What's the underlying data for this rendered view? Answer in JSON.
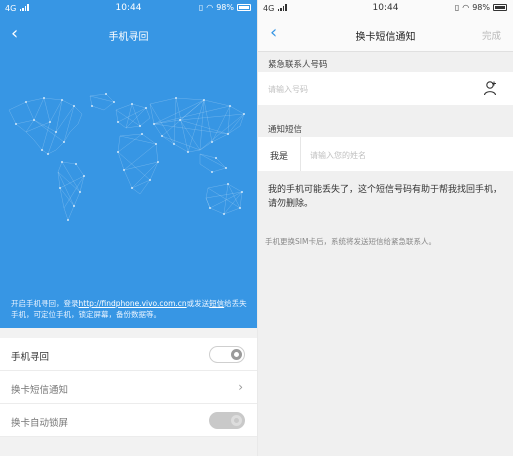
{
  "left": {
    "status": {
      "network": "4G",
      "time": "10:44",
      "battery": "98%"
    },
    "title": "手机寻回",
    "promo_text_before": "开启手机寻回，登录",
    "promo_link": "http://findphone.vivo.com.cn",
    "promo_text_mid": "或发送",
    "promo_link2": "短信",
    "promo_text_after": "给丢失手机，可定位手机，锁定屏幕，备份数据等。",
    "settings": [
      {
        "label": "手机寻回",
        "control": "toggle",
        "state": "off"
      },
      {
        "label": "换卡短信通知",
        "control": "chevron"
      },
      {
        "label": "换卡自动锁屏",
        "control": "toggle",
        "state": "disabled"
      }
    ],
    "colors": {
      "header_bg": "#3796e4"
    }
  },
  "right": {
    "status": {
      "network": "4G",
      "time": "10:44",
      "battery": "98%"
    },
    "title": "换卡短信通知",
    "done_label": "完成",
    "section_contact": "紧急联系人号码",
    "contact_placeholder": "请输入号码",
    "section_sms": "通知短信",
    "me_label": "我是",
    "name_placeholder": "请输入您的姓名",
    "message": "我的手机可能丢失了，这个短信号码有助于帮我找回手机，请勿删除。",
    "hint": "手机更换SIM卡后，系统将发送短信给紧急联系人。"
  }
}
